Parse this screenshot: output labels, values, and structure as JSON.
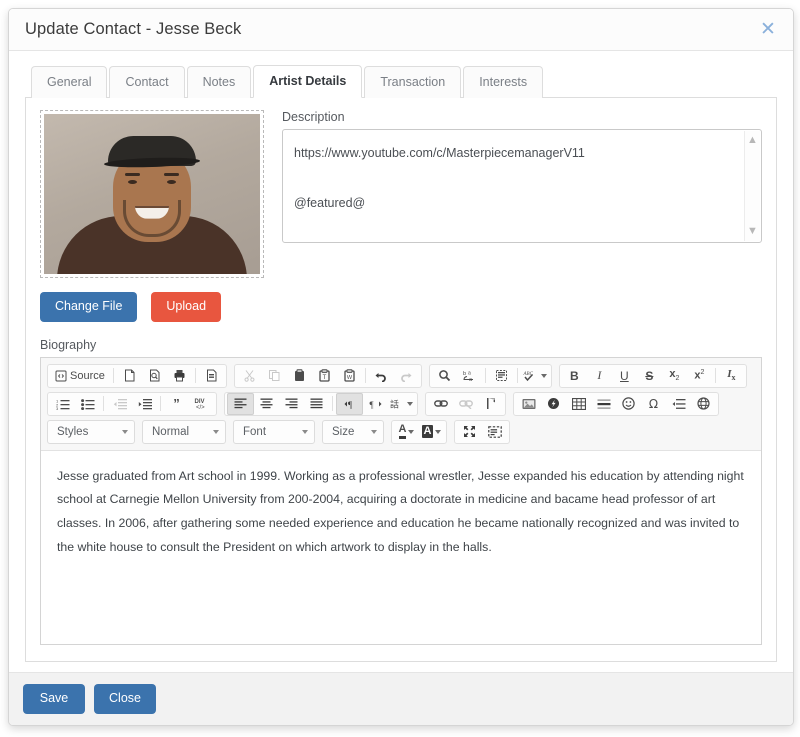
{
  "dialog": {
    "title": "Update Contact - Jesse Beck",
    "close_icon": "close-icon"
  },
  "tabs": [
    {
      "label": "General",
      "active": false
    },
    {
      "label": "Contact",
      "active": false
    },
    {
      "label": "Notes",
      "active": false
    },
    {
      "label": "Artist Details",
      "active": true
    },
    {
      "label": "Transaction",
      "active": false
    },
    {
      "label": "Interests",
      "active": false
    }
  ],
  "photo": {
    "alt": "contact-photo"
  },
  "photo_buttons": {
    "change_file": "Change File",
    "upload": "Upload"
  },
  "description": {
    "label": "Description",
    "value": "https://www.youtube.com/c/MasterpiecemanagerV11\n\n@featured@",
    "line1": "https://www.youtube.com/c/MasterpiecemanagerV11",
    "line2": "@featured@",
    "scroll_up": "⌃",
    "scroll_down": "⌄"
  },
  "biography": {
    "label": "Biography",
    "text": "Jesse graduated from Art school in 1999. Working as a professional wrestler, Jesse expanded his education by attending night school at Carnegie Mellon University from 200-2004, acquiring a doctorate in medicine and bacame head professor of art classes. In 2006, after gathering some needed experience and education he became nationally recognized and was invited to the white house to consult the President on which artwork to display in the halls."
  },
  "editor_toolbar": {
    "source_label": "Source",
    "row1": [
      {
        "name": "source-button",
        "label": "Source",
        "state": "enabled"
      },
      {
        "name": "new-page-icon",
        "label": "New Page",
        "state": "enabled"
      },
      {
        "name": "preview-icon",
        "label": "Preview",
        "state": "enabled"
      },
      {
        "name": "print-icon",
        "label": "Print",
        "state": "enabled"
      },
      {
        "name": "templates-icon",
        "label": "Templates",
        "state": "enabled"
      },
      {
        "name": "cut-icon",
        "label": "Cut",
        "state": "disabled"
      },
      {
        "name": "copy-icon",
        "label": "Copy",
        "state": "disabled"
      },
      {
        "name": "paste-icon",
        "label": "Paste",
        "state": "enabled"
      },
      {
        "name": "paste-text-icon",
        "label": "Paste as plain text",
        "state": "enabled"
      },
      {
        "name": "paste-word-icon",
        "label": "Paste from Word",
        "state": "enabled"
      },
      {
        "name": "undo-icon",
        "label": "Undo",
        "state": "enabled"
      },
      {
        "name": "redo-icon",
        "label": "Redo",
        "state": "disabled"
      },
      {
        "name": "find-icon",
        "label": "Find",
        "state": "enabled"
      },
      {
        "name": "replace-icon",
        "label": "Replace",
        "state": "enabled"
      },
      {
        "name": "select-all-icon",
        "label": "Select All",
        "state": "enabled"
      },
      {
        "name": "spellcheck-icon",
        "label": "Spell Check As You Type",
        "state": "enabled"
      },
      {
        "name": "bold-icon",
        "label": "Bold",
        "state": "enabled"
      },
      {
        "name": "italic-icon",
        "label": "Italic",
        "state": "enabled"
      },
      {
        "name": "underline-icon",
        "label": "Underline",
        "state": "enabled"
      },
      {
        "name": "strikethrough-icon",
        "label": "Strike Through",
        "state": "enabled"
      },
      {
        "name": "subscript-icon",
        "label": "Subscript",
        "state": "enabled"
      },
      {
        "name": "superscript-icon",
        "label": "Superscript",
        "state": "enabled"
      },
      {
        "name": "remove-format-icon",
        "label": "Remove Format",
        "state": "enabled"
      }
    ],
    "row2": [
      {
        "name": "numbered-list-icon",
        "label": "Insert/Remove Numbered List",
        "state": "enabled"
      },
      {
        "name": "bulleted-list-icon",
        "label": "Insert/Remove Bulleted List",
        "state": "enabled"
      },
      {
        "name": "decrease-indent-icon",
        "label": "Decrease Indent",
        "state": "disabled"
      },
      {
        "name": "increase-indent-icon",
        "label": "Increase Indent",
        "state": "enabled"
      },
      {
        "name": "blockquote-icon",
        "label": "Block Quote",
        "state": "enabled"
      },
      {
        "name": "div-container-icon",
        "label": "Create Div Container",
        "state": "enabled"
      },
      {
        "name": "align-left-icon",
        "label": "Align Left",
        "state": "active"
      },
      {
        "name": "align-center-icon",
        "label": "Center",
        "state": "enabled"
      },
      {
        "name": "align-right-icon",
        "label": "Align Right",
        "state": "enabled"
      },
      {
        "name": "justify-icon",
        "label": "Justify",
        "state": "enabled"
      },
      {
        "name": "text-direction-ltr-icon",
        "label": "Text direction from left to right",
        "state": "active"
      },
      {
        "name": "text-direction-rtl-icon",
        "label": "Text direction from right to left",
        "state": "enabled"
      },
      {
        "name": "language-icon",
        "label": "Set language",
        "state": "enabled"
      },
      {
        "name": "link-icon",
        "label": "Link",
        "state": "enabled"
      },
      {
        "name": "unlink-icon",
        "label": "Unlink",
        "state": "disabled"
      },
      {
        "name": "anchor-icon",
        "label": "Anchor",
        "state": "enabled"
      },
      {
        "name": "image-icon",
        "label": "Image",
        "state": "enabled"
      },
      {
        "name": "flash-icon",
        "label": "Flash",
        "state": "enabled"
      },
      {
        "name": "table-icon",
        "label": "Table",
        "state": "enabled"
      },
      {
        "name": "horizontal-rule-icon",
        "label": "Insert Horizontal Line",
        "state": "enabled"
      },
      {
        "name": "smiley-icon",
        "label": "Smiley",
        "state": "enabled"
      },
      {
        "name": "special-char-icon",
        "label": "Insert Special Character",
        "state": "enabled"
      },
      {
        "name": "page-break-icon",
        "label": "Insert Page Break for Printing",
        "state": "enabled"
      },
      {
        "name": "iframe-icon",
        "label": "IFrame",
        "state": "enabled"
      }
    ],
    "combos": [
      {
        "name": "styles-combo",
        "label": "Styles"
      },
      {
        "name": "format-combo",
        "label": "Normal"
      },
      {
        "name": "font-combo",
        "label": "Font"
      },
      {
        "name": "size-combo",
        "label": "Size"
      }
    ],
    "row3_icons": [
      {
        "name": "text-color-icon",
        "label": "Text Color",
        "glyph": "A"
      },
      {
        "name": "background-color-icon",
        "label": "Background Color",
        "glyph": "A"
      },
      {
        "name": "maximize-icon",
        "label": "Maximize",
        "state": "enabled"
      },
      {
        "name": "show-blocks-icon",
        "label": "Show Blocks",
        "state": "enabled"
      }
    ]
  },
  "footer": {
    "save": "Save",
    "close": "Close"
  },
  "colors": {
    "primary_blue": "#3b73ad",
    "upload_red": "#e8563f",
    "close_icon": "#8ab0db",
    "footer_bg": "#f2f2f2"
  }
}
